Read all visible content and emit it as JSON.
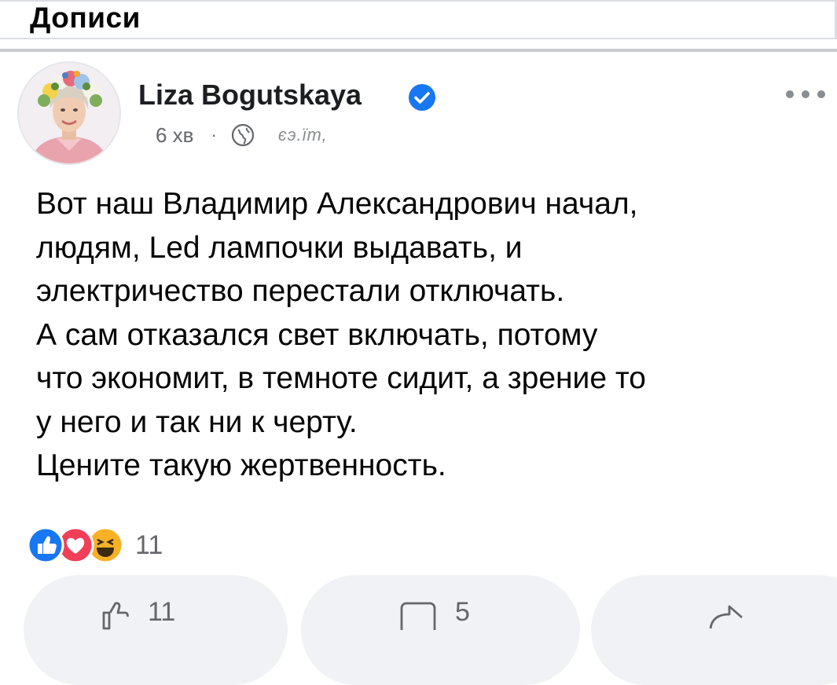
{
  "header": {
    "title": "Дописи"
  },
  "post": {
    "author": "Liza Bogutskaya",
    "time": "6 хв",
    "edited": "єэ.їт,",
    "text_lines": [
      "Вот наш Владимир Александрович начал,",
      "людям, Led лампочки выдавать, и",
      "электричество перестали отключать.",
      "А сам отказался свет включать, потому",
      "что экономит, в темноте сидит, а зрение то",
      "у него и так ни к черту.",
      "Цените такую жертвенность."
    ],
    "reaction_count": "11",
    "reaction_icons": [
      "like-icon",
      "love-icon",
      "haha-icon"
    ]
  },
  "actions": {
    "like_count": "11",
    "comment_count": "5"
  },
  "colors": {
    "accent": "#1877f2",
    "love": "#f33e58",
    "haha": "#f7b125",
    "secondary_text": "#65676b",
    "button_bg": "#f0f2f5"
  }
}
